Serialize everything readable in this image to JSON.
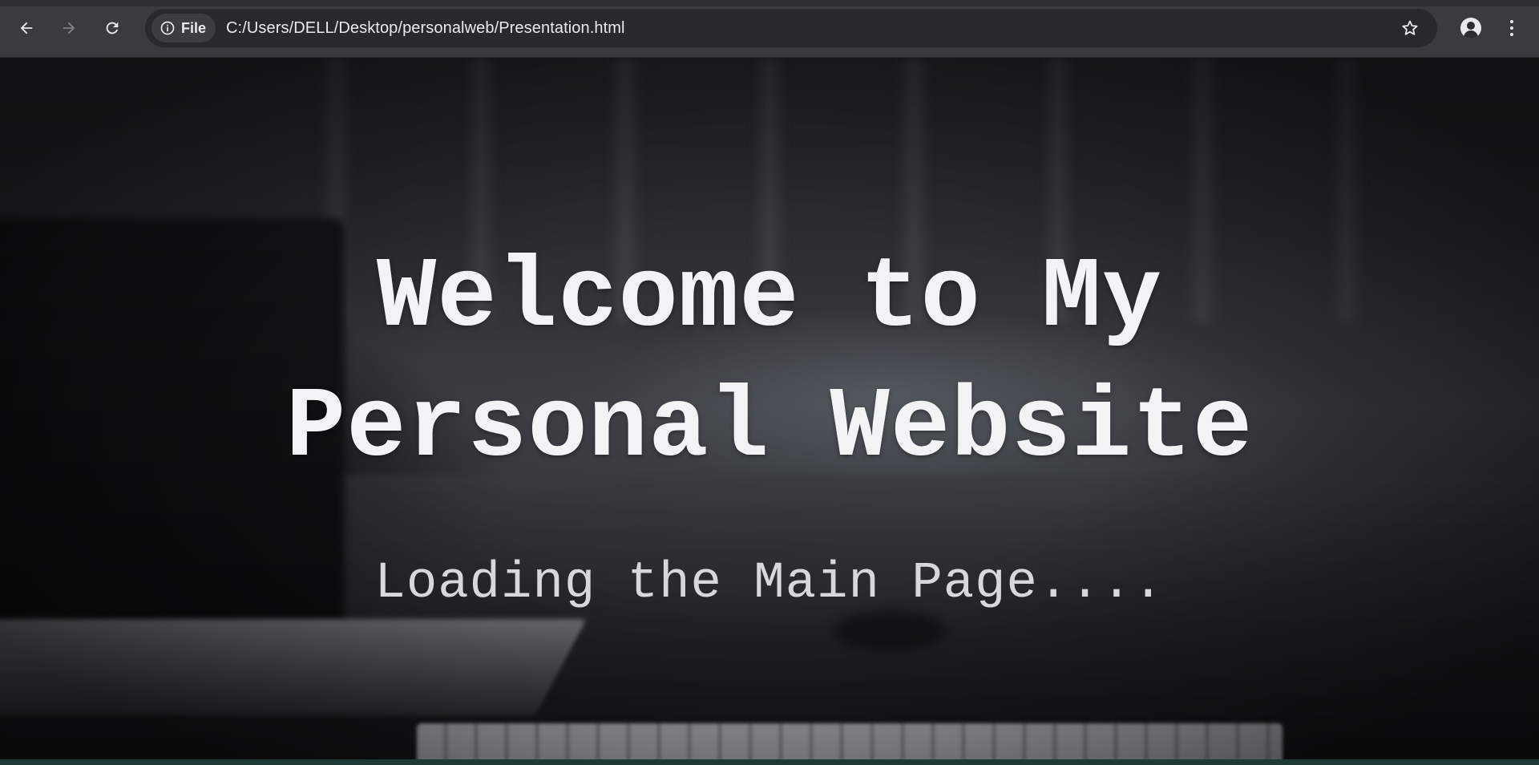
{
  "browser": {
    "site_chip_label": "File",
    "url": "C:/Users/DELL/Desktop/personalweb/Presentation.html",
    "icons": {
      "back": "back-arrow-icon",
      "forward": "forward-arrow-icon",
      "reload": "reload-icon",
      "site_info": "info-icon",
      "bookmark": "star-icon",
      "profile": "profile-icon",
      "menu": "kebab-menu-icon"
    }
  },
  "page": {
    "headline_line1": "Welcome to My",
    "headline_line2": "Personal Website",
    "subline": "Loading the Main Page...."
  }
}
